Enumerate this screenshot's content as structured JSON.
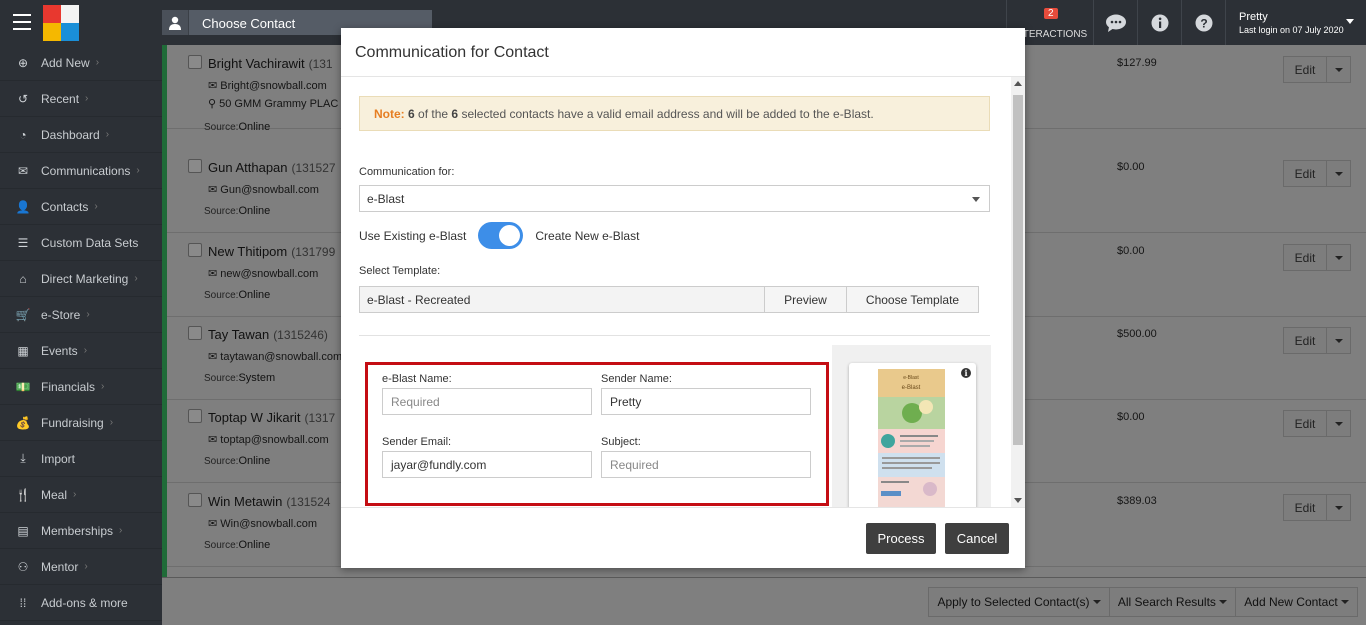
{
  "header": {
    "contact_search_label": "Choose Contact",
    "interactions_label": "INTERACTIONS",
    "interactions_count": "2",
    "user_name": "Pretty",
    "last_login": "Last login on 07 July 2020"
  },
  "sidebar": {
    "items": [
      {
        "label": "Add New",
        "icon": "plus-circle-icon"
      },
      {
        "label": "Recent",
        "icon": "history-icon"
      },
      {
        "label": "Dashboard",
        "icon": "gauge-icon"
      },
      {
        "label": "Communications",
        "icon": "envelope-icon"
      },
      {
        "label": "Contacts",
        "icon": "user-icon"
      },
      {
        "label": "Custom Data Sets",
        "icon": "database-icon"
      },
      {
        "label": "Direct Marketing",
        "icon": "building-icon"
      },
      {
        "label": "e-Store",
        "icon": "cart-icon"
      },
      {
        "label": "Events",
        "icon": "calendar-icon"
      },
      {
        "label": "Financials",
        "icon": "money-icon"
      },
      {
        "label": "Fundraising",
        "icon": "moneybag-icon"
      },
      {
        "label": "Import",
        "icon": "download-icon"
      },
      {
        "label": "Meal",
        "icon": "cutlery-icon"
      },
      {
        "label": "Memberships",
        "icon": "id-card-icon"
      },
      {
        "label": "Mentor",
        "icon": "mentor-icon"
      },
      {
        "label": "Add-ons & more",
        "icon": "grid-icon"
      }
    ]
  },
  "contacts": [
    {
      "name": "Bright Vachirawit",
      "id": "(131",
      "email": "Bright@snowball.com",
      "address": "50 GMM Grammy PLAC",
      "source_label": "Source:",
      "source": "Online",
      "amount": "$127.99"
    },
    {
      "name": "Gun Atthapan",
      "id": "(131527",
      "email": "Gun@snowball.com",
      "address": "",
      "source_label": "Source:",
      "source": "Online",
      "amount": "$0.00"
    },
    {
      "name": "New Thitipom",
      "id": "(131799",
      "email": "new@snowball.com",
      "address": "",
      "source_label": "Source:",
      "source": "Online",
      "amount": "$0.00"
    },
    {
      "name": "Tay Tawan",
      "id": "(1315246)",
      "email": "taytawan@snowball.com",
      "address": "",
      "source_label": "Source:",
      "source": "System",
      "amount": "$500.00"
    },
    {
      "name": "Toptap W Jikarit",
      "id": "(1317",
      "email": "toptap@snowball.com",
      "address": "",
      "source_label": "Source:",
      "source": "Online",
      "amount": "$0.00"
    },
    {
      "name": "Win Metawin",
      "id": "(131524",
      "email": "Win@snowball.com",
      "address": "",
      "source_label": "Source:",
      "source": "Online",
      "amount": "$389.03"
    }
  ],
  "row_actions": {
    "edit_label": "Edit"
  },
  "bottom_actions": {
    "apply_selected": "Apply to Selected Contact(s)",
    "all_results": "All Search Results",
    "add_new_contact": "Add New Contact"
  },
  "modal": {
    "title": "Communication for Contact",
    "note_label": "Note:",
    "note_valid_count": "6",
    "note_text_1": "of the",
    "note_total_count": "6",
    "note_text_2": "selected contacts have a valid email address and will be added to the e-Blast.",
    "communication_for_label": "Communication for:",
    "communication_for_value": "e-Blast",
    "toggle_left_label": "Use Existing e-Blast",
    "toggle_right_label": "Create New e-Blast",
    "toggle_state": "Create New e-Blast",
    "select_template_label": "Select Template:",
    "template_value": "e-Blast - Recreated",
    "preview_button": "Preview",
    "choose_template_button": "Choose Template",
    "eblast_name_label": "e-Blast Name:",
    "eblast_name_placeholder": "Required",
    "sender_name_label": "Sender Name:",
    "sender_name_value": "Pretty",
    "sender_email_label": "Sender Email:",
    "sender_email_value": "jayar@fundly.com",
    "subject_label": "Subject:",
    "subject_placeholder": "Required",
    "process_button": "Process",
    "cancel_button": "Cancel"
  },
  "colors": {
    "accent_toggle": "#3d8ee8",
    "note_highlight": "#e67e22",
    "highlight_box": "#c40d13",
    "topbar": "#2c3036",
    "badge": "#e74c3c"
  }
}
